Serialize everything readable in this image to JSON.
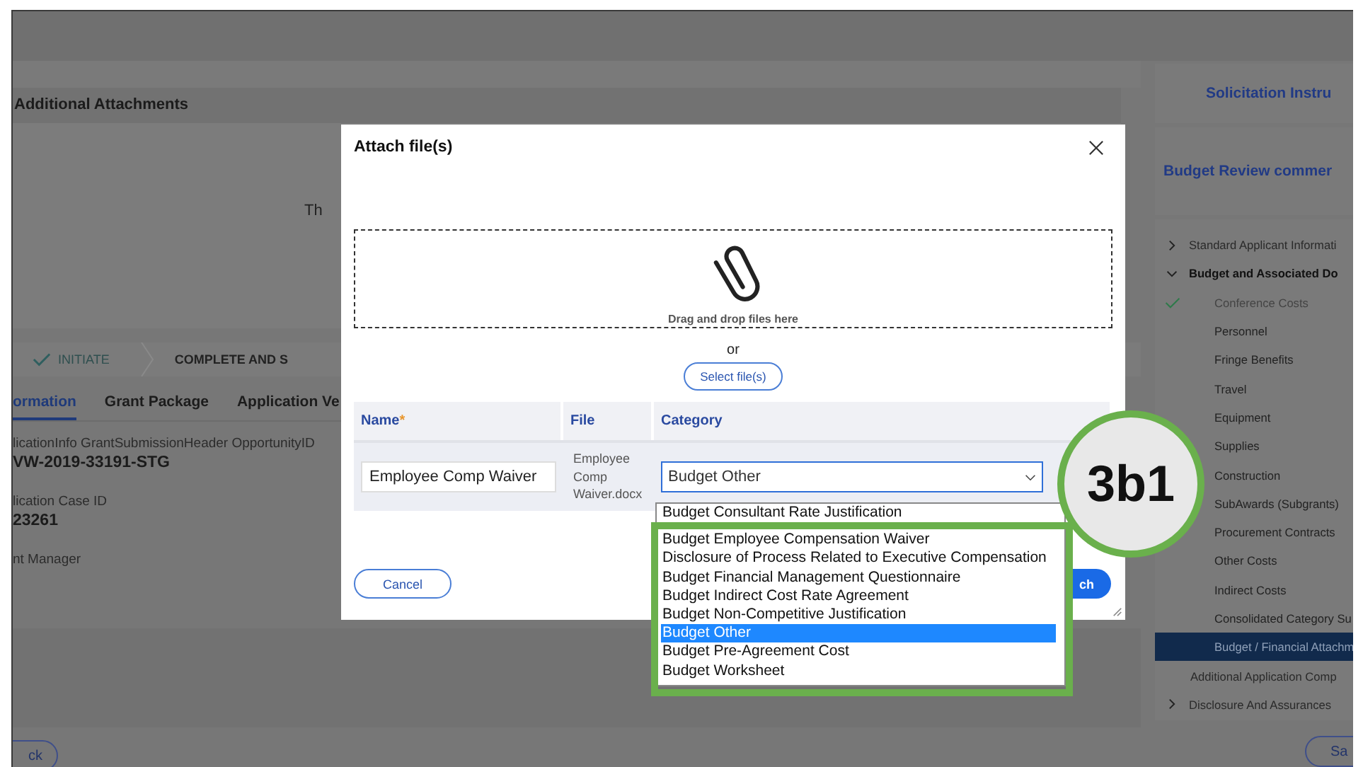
{
  "page": {
    "section_title": "Additional Attachments",
    "section_text": "Th",
    "stepper": [
      {
        "label": "INITIATE",
        "done": true
      },
      {
        "label": "COMPLETE AND S",
        "done": false
      }
    ],
    "tabs": [
      {
        "label": "ormation",
        "selected": true
      },
      {
        "label": "Grant Package",
        "selected": false
      },
      {
        "label": "Application Ve",
        "selected": false
      }
    ],
    "fields": [
      {
        "label": "licationInfo GrantSubmissionHeader OpportunityID",
        "value": "VW-2019-33191-STG"
      },
      {
        "label": "lication Case ID",
        "value": "23261"
      },
      {
        "label": "nt Manager"
      }
    ],
    "back_button": "ck"
  },
  "sidebar": {
    "cards": [
      "Solicitation Instru",
      "Budget Review commer"
    ],
    "nav": [
      {
        "label": "Standard Applicant Informati",
        "expanded": false,
        "selected": false
      },
      {
        "label": "Budget and Associated Do",
        "expanded": true,
        "selected": false,
        "children": [
          {
            "label": "Conference Costs",
            "done": true,
            "selected": false
          },
          {
            "label": "Personnel",
            "done": false,
            "selected": false
          },
          {
            "label": "Fringe Benefits",
            "done": false,
            "selected": false
          },
          {
            "label": "Travel",
            "done": false,
            "selected": false
          },
          {
            "label": "Equipment",
            "done": false,
            "selected": false
          },
          {
            "label": "Supplies",
            "done": false,
            "selected": false
          },
          {
            "label": "Construction",
            "done": false,
            "selected": false
          },
          {
            "label": "SubAwards (Subgrants)",
            "done": false,
            "selected": false
          },
          {
            "label": "Procurement Contracts",
            "done": false,
            "selected": false
          },
          {
            "label": "Other Costs",
            "done": false,
            "selected": false
          },
          {
            "label": "Indirect Costs",
            "done": false,
            "selected": false
          },
          {
            "label": "Consolidated Category Su",
            "done": false,
            "selected": false
          },
          {
            "label": "Budget / Financial Attachm",
            "done": false,
            "selected": true
          }
        ]
      },
      {
        "label": "Additional Application Comp",
        "selected": false
      },
      {
        "label": "Disclosure And Assurances",
        "expanded": false,
        "selected": false
      }
    ],
    "save_button": "Sa"
  },
  "dialog": {
    "title": "Attach file(s)",
    "drop_text": "Drag and drop files here",
    "or": "or",
    "select_button": "Select file(s)",
    "columns": [
      {
        "label": "Name",
        "required_mark": "*"
      },
      {
        "label": "File"
      },
      {
        "label": "Category"
      }
    ],
    "row": {
      "name": "Employee Comp Waiver",
      "file": "Employee Comp Waiver.docx",
      "category": "Budget Other"
    },
    "category_options": [
      {
        "label": "Budget Consultant Rate Justification",
        "selected": false
      },
      {
        "label": "Budget Employee Compensation Waiver",
        "selected": false
      },
      {
        "label": "Disclosure of Process Related to Executive Compensation",
        "selected": false
      },
      {
        "label": "Budget Financial Management Questionnaire",
        "selected": false
      },
      {
        "label": "Budget Indirect Cost Rate Agreement",
        "selected": false
      },
      {
        "label": "Budget Non-Competitive Justification",
        "selected": false
      },
      {
        "label": "Budget Other",
        "selected": true
      },
      {
        "label": "Budget Pre-Agreement Cost",
        "selected": false
      },
      {
        "label": "Budget Worksheet",
        "selected": false
      }
    ],
    "cancel_button": "Cancel",
    "attach_button": "ch"
  },
  "step_badge": "3b1"
}
